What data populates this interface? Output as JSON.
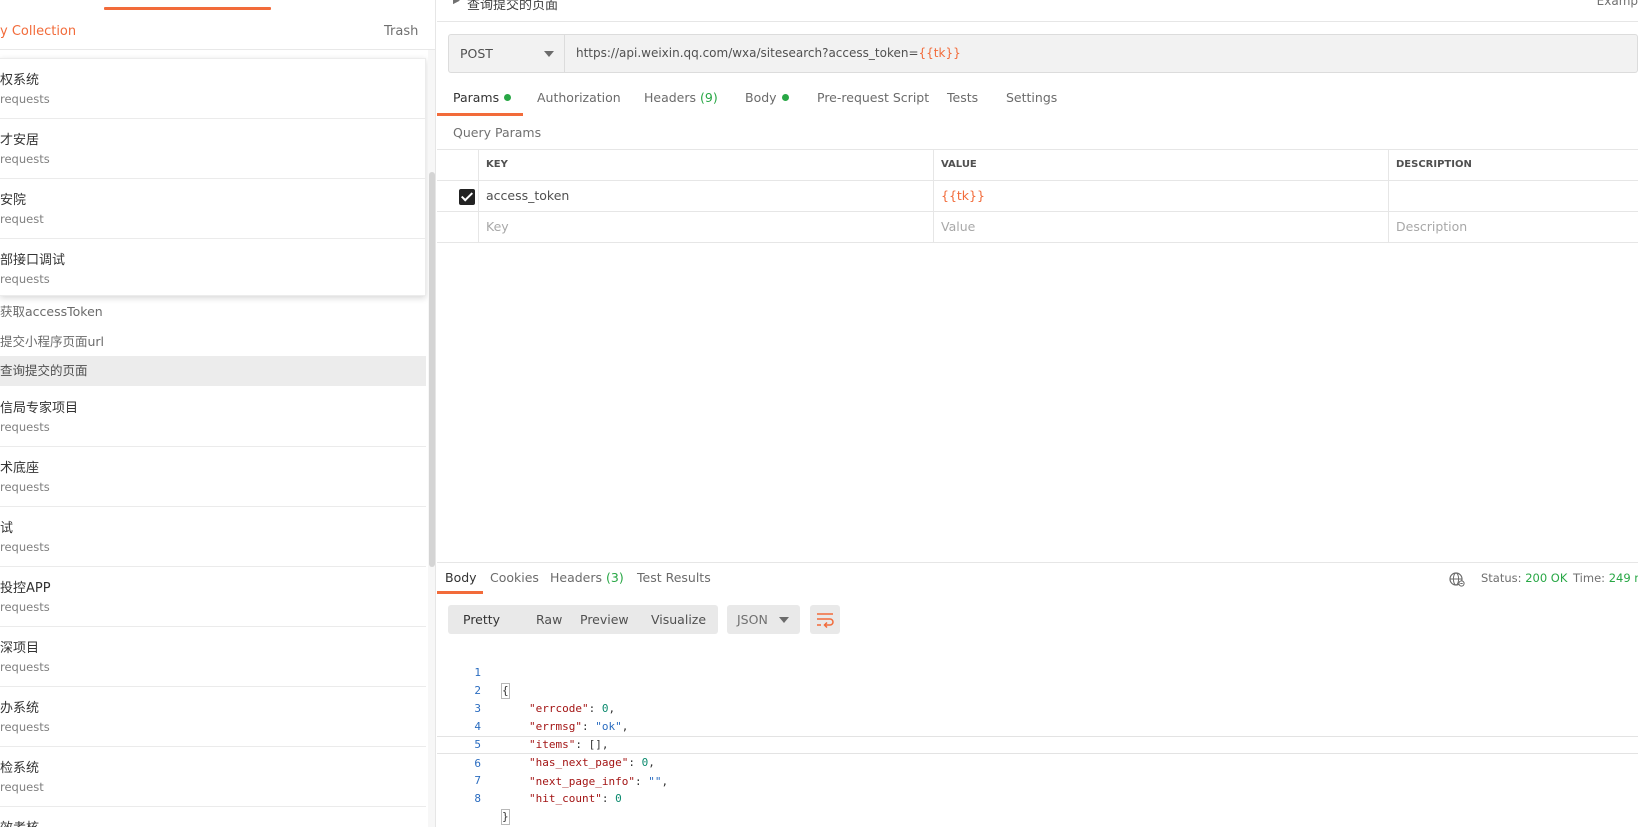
{
  "sidebar": {
    "new_collection": "y Collection",
    "trash": "Trash",
    "expanded": [
      {
        "name": "权系统",
        "count": "requests"
      },
      {
        "name": "才安居",
        "count": "requests"
      },
      {
        "name": "安院",
        "count": "request"
      },
      {
        "name": "部接口调试",
        "count": "requests"
      }
    ],
    "requests": [
      {
        "label": "获取accessToken"
      },
      {
        "label": "提交小程序页面url"
      },
      {
        "label": "查询提交的页面"
      }
    ],
    "collections": [
      {
        "name": "信局专家项目",
        "count": "requests"
      },
      {
        "name": "术底座",
        "count": " requests"
      },
      {
        "name": "试",
        "count": "requests"
      },
      {
        "name": "投控APP",
        "count": "requests"
      },
      {
        "name": "深项目",
        "count": " requests"
      },
      {
        "name": "办系统",
        "count": " requests"
      },
      {
        "name": "检系统",
        "count": "request"
      },
      {
        "name": "效考核",
        "count": ""
      }
    ]
  },
  "breadcrumb": {
    "title": "查询提交的页面",
    "examples": "Examp"
  },
  "request": {
    "method": "POST",
    "url_base": "https://api.weixin.qq.com/wxa/sitesearch?access_token=",
    "url_var": "{{tk}}",
    "tabs": {
      "params": "Params",
      "authorization": "Authorization",
      "headers": "Headers",
      "headers_count": "(9)",
      "body": "Body",
      "pre_request": "Pre-request Script",
      "tests": "Tests",
      "settings": "Settings"
    },
    "query_params_title": "Query Params",
    "table": {
      "headers": {
        "key": "KEY",
        "value": "VALUE",
        "description": "DESCRIPTION"
      },
      "rows": [
        {
          "key": "access_token",
          "value": "{{tk}}",
          "description": ""
        }
      ],
      "placeholders": {
        "key": "Key",
        "value": "Value",
        "description": "Description"
      }
    }
  },
  "response": {
    "tabs": {
      "body": "Body",
      "cookies": "Cookies",
      "headers": "Headers",
      "headers_count": "(3)",
      "test_results": "Test Results"
    },
    "status_label": "Status:",
    "status_value": "200 OK",
    "time_label": "Time:",
    "time_value": "249 m",
    "format_buttons": {
      "pretty": "Pretty",
      "raw": "Raw",
      "preview": "Preview",
      "visualize": "Visualize"
    },
    "language": "JSON",
    "code": {
      "line_numbers": [
        "1",
        "2",
        "3",
        "4",
        "5",
        "6",
        "7",
        "8"
      ],
      "open": "{",
      "close": "}",
      "entries": [
        {
          "key": "\"errcode\"",
          "value": "0",
          "sep": ","
        },
        {
          "key": "\"errmsg\"",
          "value": "\"ok\"",
          "sep": ","
        },
        {
          "key": "\"items\"",
          "value": "[]",
          "sep": ","
        },
        {
          "key": "\"has_next_page\"",
          "value": "0",
          "sep": ","
        },
        {
          "key": "\"next_page_info\"",
          "value": "\"\"",
          "sep": ","
        },
        {
          "key": "\"hit_count\"",
          "value": "0",
          "sep": ""
        }
      ]
    }
  },
  "colors": {
    "accent": "#f26b3a",
    "success": "#28a745",
    "json_key": "#a31515",
    "json_number": "#0b8a6e",
    "json_string": "#2a6cc0"
  }
}
